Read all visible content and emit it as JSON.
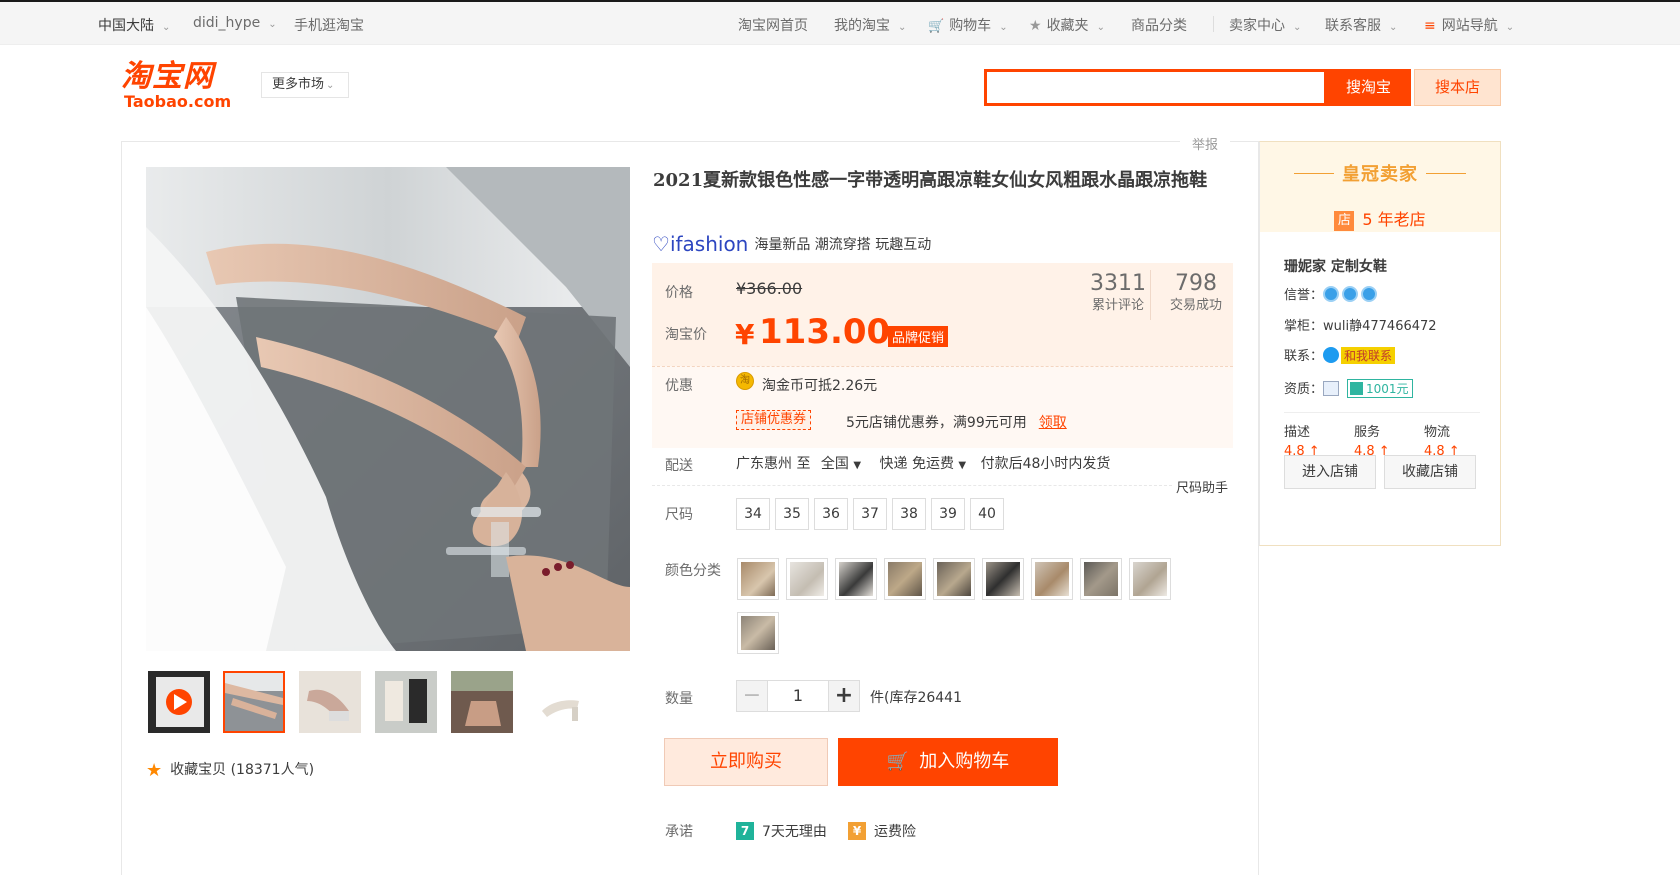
{
  "topbar": {
    "region": "中国大陆",
    "user": "didi_hype",
    "mobile": "手机逛淘宝",
    "home": "淘宝网首页",
    "my_taobao": "我的淘宝",
    "cart": "购物车",
    "favorites": "收藏夹",
    "categories": "商品分类",
    "seller_center": "卖家中心",
    "customer_service": "联系客服",
    "site_nav": "网站导航"
  },
  "header": {
    "logo_cn": "淘宝网",
    "logo_en": "Taobao.com",
    "more_market": "更多市场",
    "search_value": "",
    "search_button": "搜淘宝",
    "search_shop_button": "搜本店"
  },
  "report": "举报",
  "product": {
    "title": "2021夏新款银色性感一字带透明高跟凉鞋女仙女风粗跟水晶跟凉拖鞋",
    "ifashion_brand": "ifashion",
    "ifashion_tagline": "海量新品 潮流穿搭 玩趣互动",
    "price_label": "价格",
    "original_price": "¥366.00",
    "taobao_price_label": "淘宝价",
    "yen": "¥",
    "current_price": "113.00",
    "brand_promo": "品牌促销",
    "reviews_count": "3311",
    "reviews_label": "累计评论",
    "sales_count": "798",
    "sales_label": "交易成功",
    "promo_label": "优惠",
    "coin_text": "淘金币可抵2.26元",
    "coupon_tag": "店铺优惠券",
    "coupon_text": "5元店铺优惠券，满99元可用",
    "coupon_claim": "领取",
    "shipping_label": "配送",
    "ship_from": "广东惠州 至",
    "ship_to": "全国",
    "ship_method": "快递 免运费",
    "ship_time": "付款后48小时内发货",
    "size_helper": "尺码助手",
    "size_label": "尺码",
    "sizes": [
      "34",
      "35",
      "36",
      "37",
      "38",
      "39",
      "40"
    ],
    "color_label": "颜色分类",
    "qty_label": "数量",
    "qty_minus": "−",
    "qty_value": "1",
    "qty_plus": "+",
    "stock_text": "件(库存26441",
    "buy_now": "立即购买",
    "add_to_cart": "加入购物车",
    "promise_label": "承诺",
    "promise_1": "7天无理由",
    "promise_2": "运费险",
    "favorite_text": "收藏宝贝 (18371人气)"
  },
  "seller": {
    "crown": "皇冠卖家",
    "years_icon": "店",
    "years": "5 年老店",
    "shop_name": "珊妮家 定制女鞋",
    "credit_label": "信誉：",
    "owner_label": "掌柜：",
    "owner": "wuli静477466472",
    "contact_label": "联系：",
    "contact_tag": "和我联系",
    "qual_label": "资质：",
    "qual_tag": "1001元",
    "score_desc_label": "描述",
    "score_desc": "4.8 ↑",
    "score_service_label": "服务",
    "score_service": "4.8 ↑",
    "score_logistics_label": "物流",
    "score_logistics": "4.8 ↑",
    "enter_shop": "进入店铺",
    "fav_shop": "收藏店铺"
  },
  "colors": {
    "accent": "#ff4400",
    "crown": "#f2a034"
  }
}
